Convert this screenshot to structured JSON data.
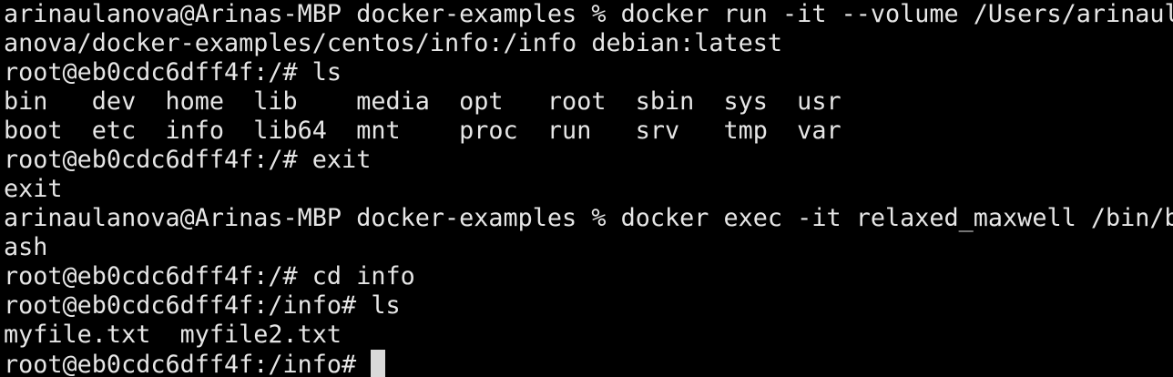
{
  "terminal": {
    "lines": [
      "arinaulanova@Arinas-MBP docker-examples % docker run -it --volume /Users/arinaul",
      "anova/docker-examples/centos/info:/info debian:latest",
      "root@eb0cdc6dff4f:/# ls",
      "bin   dev  home  lib    media  opt   root  sbin  sys  usr",
      "boot  etc  info  lib64  mnt    proc  run   srv   tmp  var",
      "root@eb0cdc6dff4f:/# exit",
      "exit",
      "arinaulanova@Arinas-MBP docker-examples % docker exec -it relaxed_maxwell /bin/b",
      "ash",
      "root@eb0cdc6dff4f:/# cd info",
      "root@eb0cdc6dff4f:/info# ls",
      "myfile.txt  myfile2.txt"
    ],
    "prompt": "root@eb0cdc6dff4f:/info#",
    "colors": {
      "background": "#000000",
      "foreground": "#e6e6e6",
      "cursor": "#d9d9d9"
    }
  }
}
